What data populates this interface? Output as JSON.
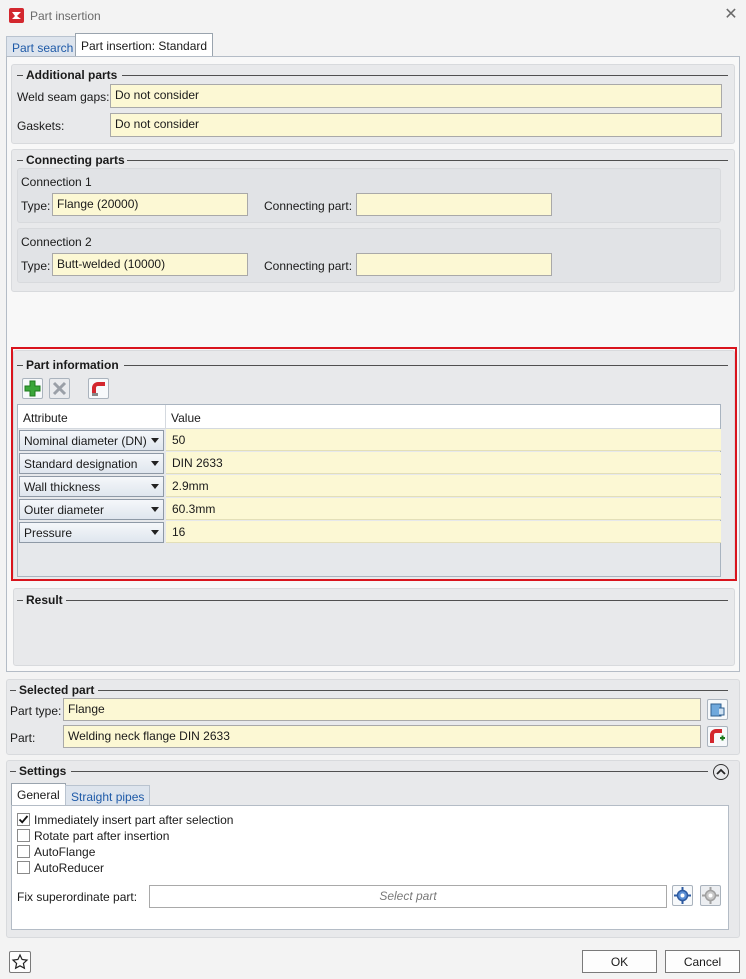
{
  "window": {
    "title": "Part insertion",
    "close_glyph": "✕"
  },
  "tabs": [
    {
      "label": "Part search"
    },
    {
      "label": "Part insertion: Standard"
    }
  ],
  "additional_parts": {
    "legend": "Additional parts",
    "weld_label": "Weld seam gaps:",
    "weld_value": "Do not consider",
    "gaskets_label": "Gaskets:",
    "gaskets_value": "Do not consider"
  },
  "connecting_parts": {
    "legend": "Connecting parts",
    "connections": [
      {
        "title": "Connection 1",
        "type_label": "Type:",
        "type_value": "Flange (20000)",
        "part_label": "Connecting part:",
        "part_value": ""
      },
      {
        "title": "Connection 2",
        "type_label": "Type:",
        "type_value": "Butt-welded (10000)",
        "part_label": "Connecting part:",
        "part_value": ""
      }
    ]
  },
  "part_information": {
    "legend": "Part information",
    "columns": [
      "Attribute",
      "Value"
    ],
    "rows": [
      {
        "attribute": "Nominal diameter (DN)",
        "value": "50"
      },
      {
        "attribute": "Standard designation",
        "value": "DIN 2633"
      },
      {
        "attribute": "Wall thickness",
        "value": "2.9mm"
      },
      {
        "attribute": "Outer diameter",
        "value": "60.3mm"
      },
      {
        "attribute": "Pressure",
        "value": "16"
      }
    ]
  },
  "result": {
    "legend": "Result"
  },
  "selected_part": {
    "legend": "Selected part",
    "type_label": "Part type:",
    "type_value": "Flange",
    "part_label": "Part:",
    "part_value": "Welding neck flange DIN 2633"
  },
  "settings": {
    "legend": "Settings",
    "tabs": [
      {
        "label": "General"
      },
      {
        "label": "Straight pipes"
      }
    ],
    "checkboxes": [
      {
        "label": "Immediately insert part after selection",
        "checked": true
      },
      {
        "label": "Rotate part after insertion",
        "checked": false
      },
      {
        "label": "AutoFlange",
        "checked": false
      },
      {
        "label": "AutoReducer",
        "checked": false
      }
    ],
    "fix_label": "Fix superordinate part:",
    "fix_placeholder": "Select part"
  },
  "footer": {
    "ok_label": "OK",
    "cancel_label": "Cancel"
  },
  "colors": {
    "highlight_frame": "#d9141d",
    "field_bg": "#fcf8d4",
    "tab_link": "#1e5aa8"
  }
}
